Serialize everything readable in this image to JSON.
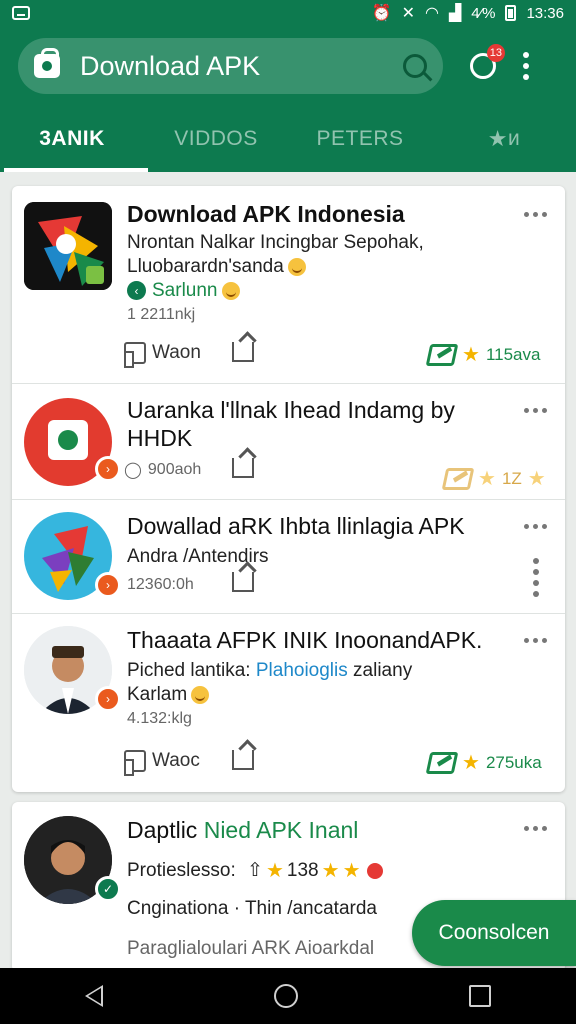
{
  "status_bar": {
    "battery": "4⁄%",
    "time": "13:36"
  },
  "search": {
    "value": "Download APK"
  },
  "notifications": {
    "count": "13"
  },
  "tabs": [
    {
      "label": "3ANIK"
    },
    {
      "label": "VIDDOS"
    },
    {
      "label": "PETERS"
    },
    {
      "label": "ᴎ"
    }
  ],
  "items": [
    {
      "title": "Download APK Indonesia",
      "line1": "Nrontan Nalkar Incingbar Sepohak,",
      "line2": "Lluobarardn'sanda",
      "line3": "Sarlunn",
      "meta": "1 2211nkj",
      "like_label": "Waon",
      "rating": "115ava"
    },
    {
      "title": "Uaranka l'llnak Ihead Indamg by HHDK",
      "meta": "900aoh",
      "rating": "1Z"
    },
    {
      "title": "Dowallad aRK Ihbta llinlagia APK",
      "line1": "Andra /Antendirs",
      "meta": "12360:0h"
    },
    {
      "title": "Thaaata AFPK INIK InoonandAPK.",
      "line1_a": "Piched lantika:",
      "line1_b": "Plahoioglis",
      "line1_c": "zaliany",
      "line2": "Karlam",
      "meta": "4.132:klg",
      "like_label": "Waoc",
      "rating": "275uka"
    },
    {
      "title_a": "Daptlic",
      "title_b": "Nied APK Inanl",
      "line1_a": "Protieslesso:",
      "line1_b": "138",
      "line2": "Cnginationa · Thin /ancatarda",
      "line3": "Paraglialoulari ARK Aioarkdal"
    }
  ],
  "fab": {
    "label": "Coonsolcen"
  },
  "colors": {
    "primary": "#0d7a4f",
    "accent": "#1a8a4a",
    "star": "#f4b400",
    "badge": "#e53935"
  }
}
